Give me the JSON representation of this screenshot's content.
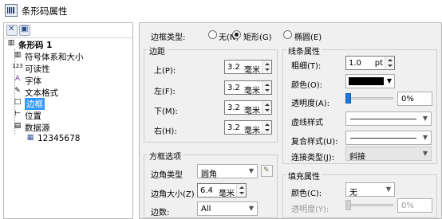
{
  "window": {
    "title": "条形码属性"
  },
  "toolbar": {
    "expand_icon": "expand-icon",
    "object_icon": "object-icon"
  },
  "tree": {
    "root": "条形码 1",
    "items": [
      {
        "label": "符号体系和大小",
        "icon": "barcode-icon",
        "glyph": "▥"
      },
      {
        "label": "可读性",
        "icon": "readability-icon",
        "glyph": "123"
      },
      {
        "label": "字体",
        "icon": "font-icon",
        "glyph": "A"
      },
      {
        "label": "文本格式",
        "icon": "text-format-icon",
        "glyph": "✎"
      },
      {
        "label": "边框",
        "icon": "border-icon",
        "glyph": "□"
      },
      {
        "label": "位置",
        "icon": "position-icon",
        "glyph": "⊢"
      },
      {
        "label": "数据源",
        "icon": "datasource-icon",
        "glyph": "▤"
      }
    ],
    "child": {
      "label": "12345678",
      "icon": "data-item-icon",
      "glyph": "▦"
    },
    "selected": "边框"
  },
  "frame_type": {
    "label": "边框类型:",
    "options": [
      "无(N)",
      "矩形(G)",
      "椭圆(E)"
    ],
    "selected": "矩形(G)"
  },
  "margin": {
    "title": "边距",
    "fields": [
      {
        "label": "上(P):",
        "value": "3.2",
        "unit": "毫米"
      },
      {
        "label": "左(F):",
        "value": "3.2",
        "unit": "毫米"
      },
      {
        "label": "下(M):",
        "value": "3.2",
        "unit": "毫米"
      },
      {
        "label": "右(H):",
        "value": "3.2",
        "unit": "毫米"
      }
    ]
  },
  "line_props": {
    "title": "线条属性",
    "thickness_label": "粗细(T):",
    "thickness_value": "1.0",
    "thickness_unit": "pt",
    "color_label": "颜色(O):",
    "color_value": "#000000",
    "opacity_label": "透明度(A):",
    "opacity_value": "0%",
    "opacity_level": 0,
    "dash_label": "虚线样式",
    "compound_label": "复合样式(U):",
    "join_label": "连接类型(J):",
    "join_value": "斜接"
  },
  "box_options": {
    "title": "方框选项",
    "corner_type_label": "边角类型",
    "corner_type_value": "圆角",
    "corner_size_label": "边角大小(Z)",
    "corner_size_value": "6.4",
    "corner_size_unit": "毫米",
    "sides_label": "边数:",
    "sides_value": "All"
  },
  "fill_props": {
    "title": "填充属性",
    "color_label": "颜色(C):",
    "color_value": "无",
    "opacity_label": "透明度(Y):",
    "opacity_value": "0%",
    "opacity_level": 0
  }
}
